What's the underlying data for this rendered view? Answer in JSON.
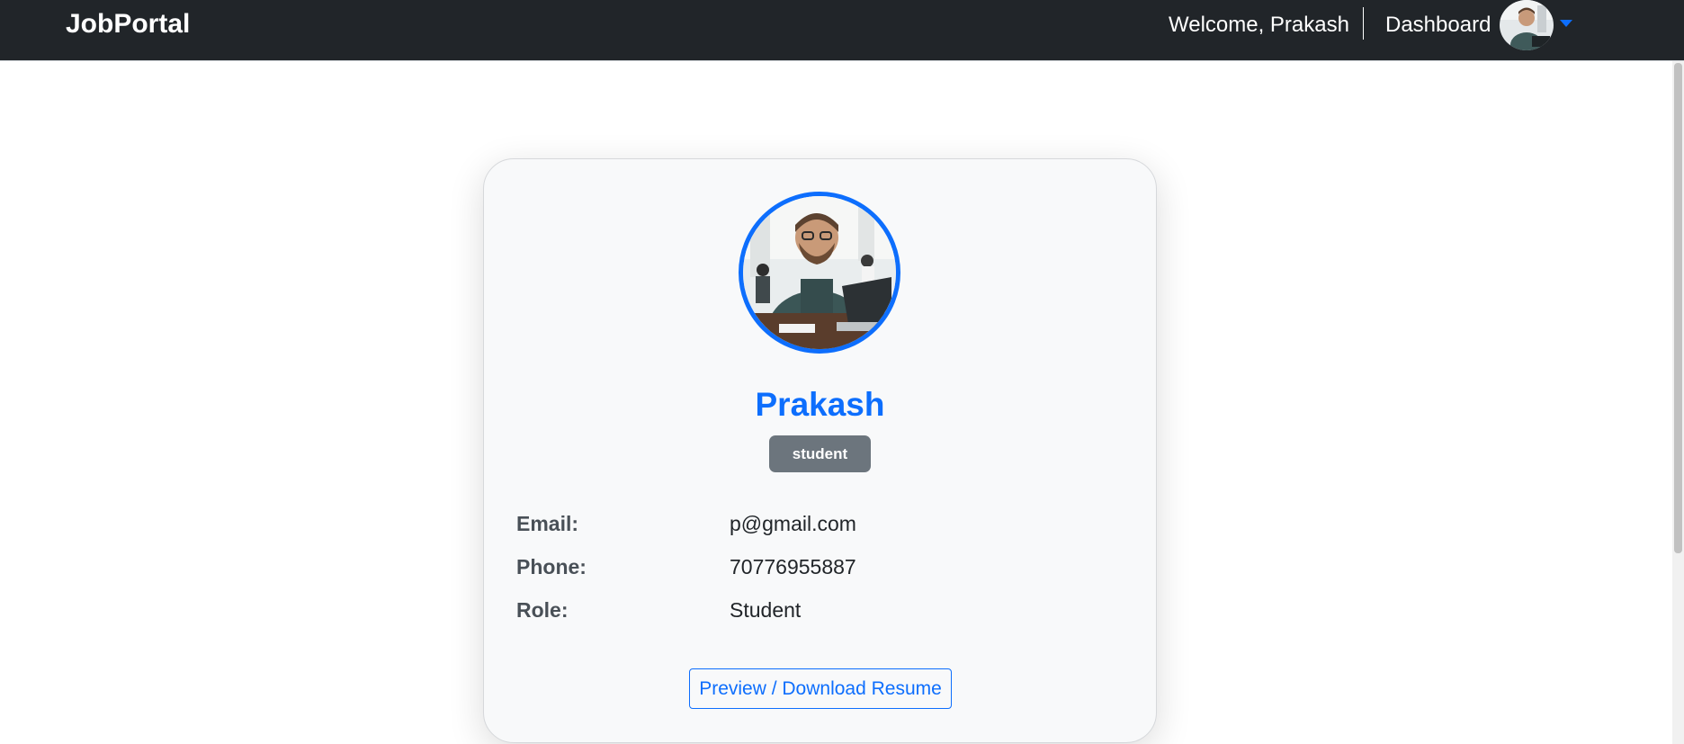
{
  "navbar": {
    "brand": "JobPortal",
    "welcome": "Welcome, Prakash",
    "dashboard_label": "Dashboard",
    "avatar_icon": "user-avatar-photo",
    "caret_icon": "caret-down-icon"
  },
  "profile": {
    "name": "Prakash",
    "role_badge": "student",
    "fields": [
      {
        "label": "Email:",
        "value": "p@gmail.com"
      },
      {
        "label": "Phone:",
        "value": "70776955887"
      },
      {
        "label": "Role:",
        "value": "Student"
      }
    ],
    "resume_button": "Preview / Download Resume"
  },
  "colors": {
    "navbar_bg": "#212529",
    "accent": "#0d6efd",
    "badge_bg": "#6c757d",
    "card_bg": "#f8f9fa"
  }
}
